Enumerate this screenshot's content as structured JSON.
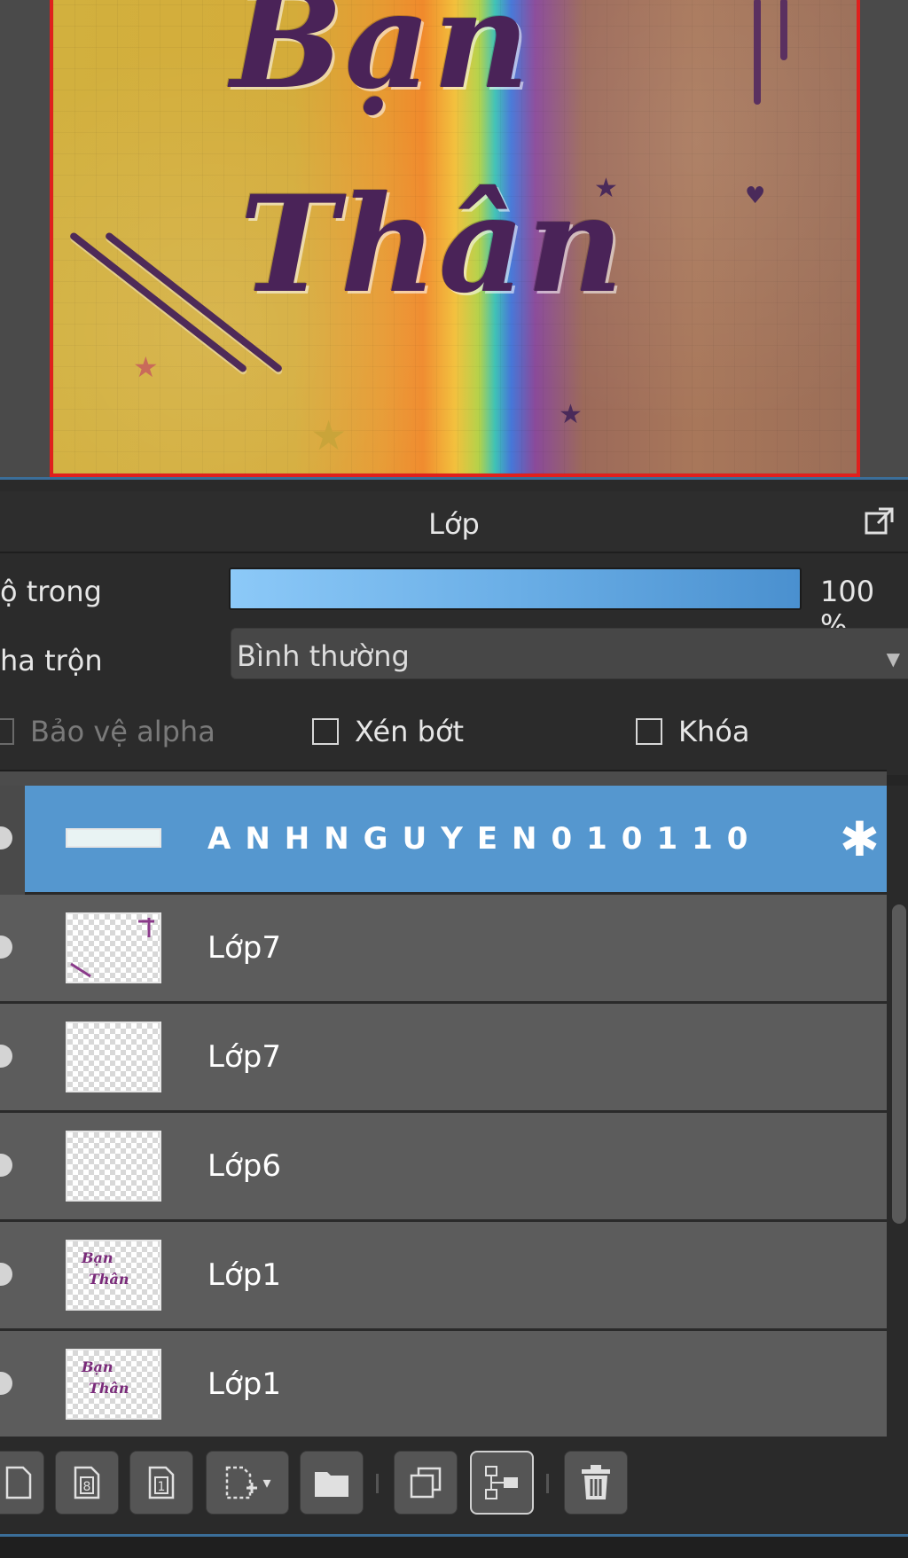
{
  "canvas": {
    "artwork_line1": "Bạn",
    "artwork_line2": "Thân"
  },
  "panel": {
    "title": "Lớp",
    "popout_icon": "popout-icon"
  },
  "properties": {
    "opacity_label": "ộ trong",
    "opacity_value": "100 %",
    "opacity_fraction": 1.0,
    "blend_label": "ha trộn",
    "blend_value": "Bình thường",
    "alpha_protect_label": "Bảo vệ alpha",
    "clipping_label": "Xén bớt",
    "lock_label": "Khóa"
  },
  "layers": [
    {
      "name": "ANHNGUYEN010110",
      "selected": true,
      "thumb": "text"
    },
    {
      "name": "Lớp7",
      "selected": false,
      "thumb": "sparse-art"
    },
    {
      "name": "Lớp7",
      "selected": false,
      "thumb": "empty"
    },
    {
      "name": "Lớp6",
      "selected": false,
      "thumb": "empty"
    },
    {
      "name": "Lớp1",
      "selected": false,
      "thumb": "lettering",
      "thumb_text1": "Bạn",
      "thumb_text2": "Thân"
    },
    {
      "name": "Lớp1",
      "selected": false,
      "thumb": "lettering",
      "thumb_text1": "Bạn",
      "thumb_text2": "Thân"
    }
  ],
  "toolbar": {
    "buttons": [
      "new-layer-icon",
      "new-8bit-layer-icon",
      "new-1bit-layer-icon",
      "add-layer-dropdown-icon",
      "folder-icon",
      "duplicate-icon",
      "merge-down-icon",
      "trash-icon"
    ],
    "add_dropdown_arrow": "▾"
  },
  "colors": {
    "accent": "#5597cf",
    "canvas_border": "#e0201d"
  }
}
